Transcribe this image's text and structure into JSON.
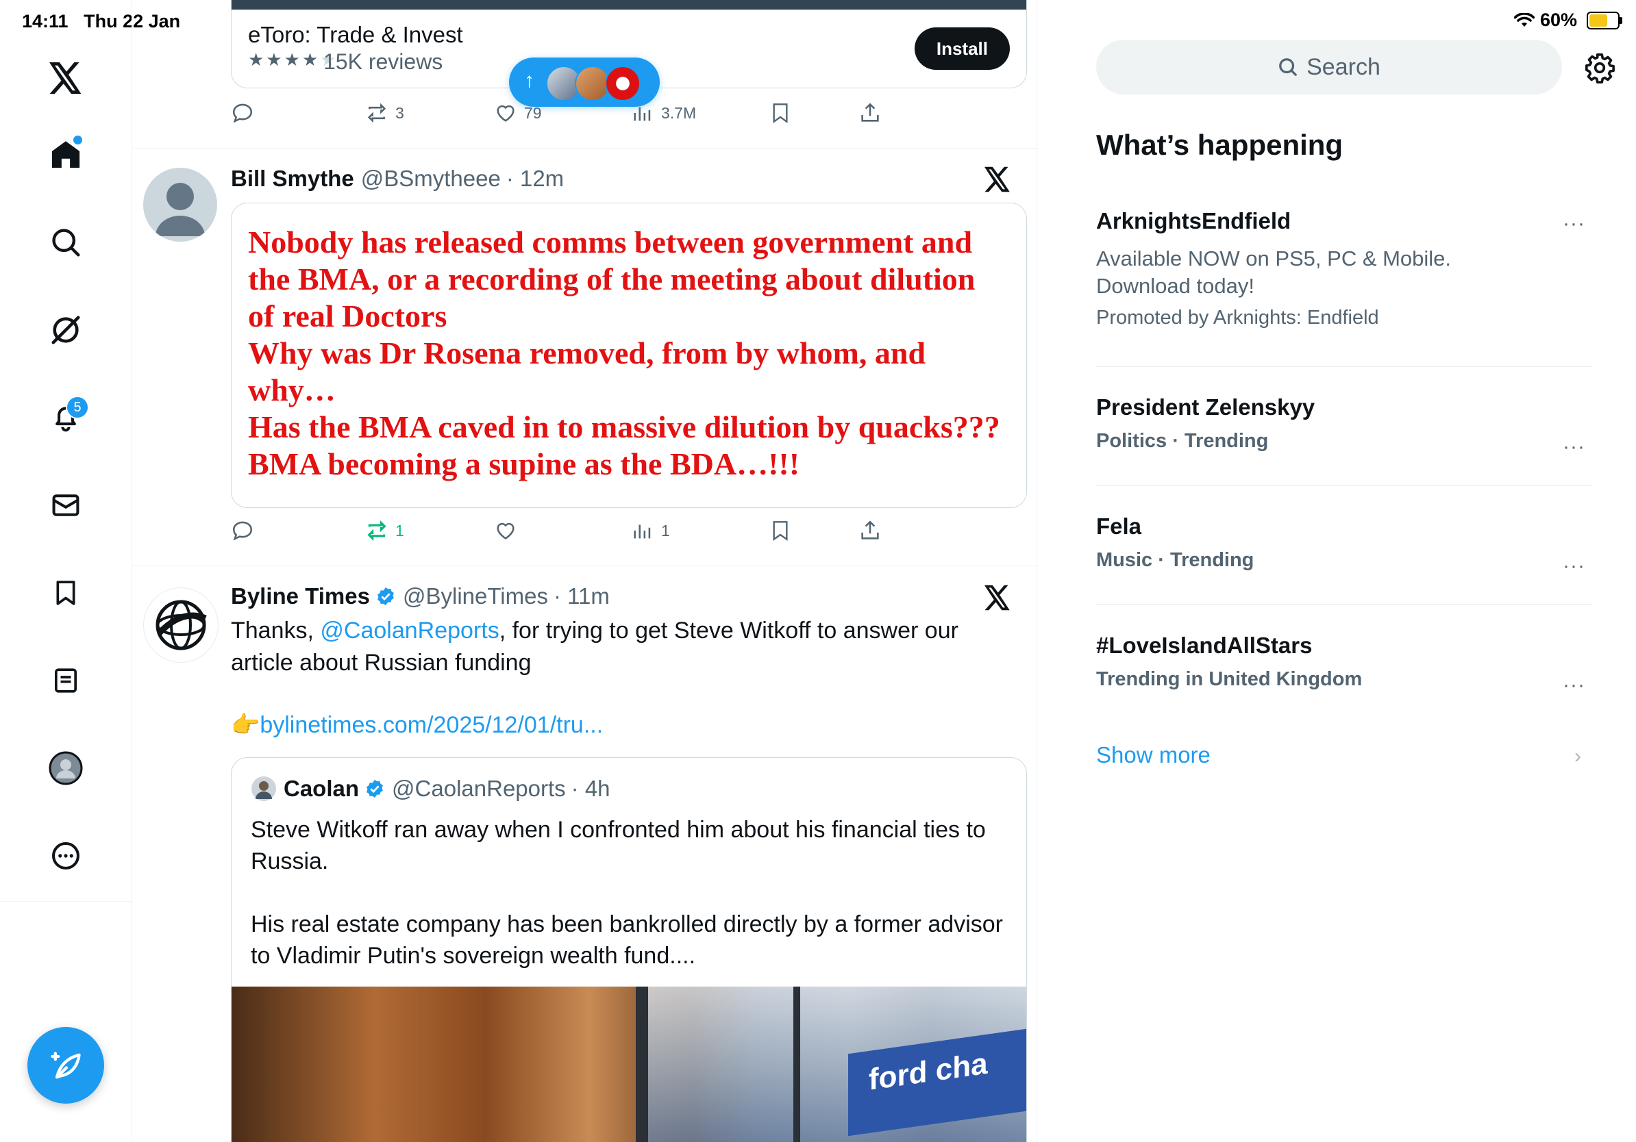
{
  "status_bar": {
    "time": "14:11",
    "date": "Thu 22 Jan",
    "battery": "60%"
  },
  "nav": {
    "notifications_badge": "5"
  },
  "ad": {
    "title": "eToro: Trade & Invest",
    "stars": "★★★★★",
    "reviews": "15K reviews",
    "install_label": "Install",
    "replies": "",
    "reposts": "3",
    "likes": "79",
    "views": "3.7M"
  },
  "post1": {
    "name": "Bill Smythe",
    "handle": "@BSmytheee",
    "time": "· 12m",
    "image_lines": [
      "Nobody has released comms between government and",
      "the BMA, or a recording of the meeting about dilution",
      "of real Doctors",
      "Why was Dr Rosena removed, from by whom, and",
      "why…",
      "Has the BMA caved in to massive dilution by quacks???",
      "BMA becoming a supine as the BDA…!!!"
    ],
    "reposts": "1",
    "views": "1"
  },
  "post2": {
    "name": "Byline Times",
    "handle": "@BylineTimes",
    "time": "· 11m",
    "text_before": "Thanks, ",
    "mention": "@CaolanReports",
    "text_after": ", for trying to get Steve Witkoff to answer our article about Russian funding",
    "emoji": "👉",
    "link": "bylinetimes.com/2025/12/01/tru...",
    "quote": {
      "name": "Caolan",
      "handle": "@CaolanReports",
      "time": "· 4h",
      "para1": "Steve Witkoff ran away when I confronted him about his financial ties to Russia.",
      "para2": "His real estate company has been bankrolled directly by a former advisor to Vladimir Putin's sovereign wealth fund....",
      "video_sign": "ford cha"
    }
  },
  "right": {
    "search_placeholder": "Search",
    "section_title": "What’s happening",
    "trends": [
      {
        "name": "ArknightsEndfield",
        "desc": "Available NOW on PS5, PC & Mobile. Download today!",
        "meta": "Promoted by Arknights: Endfield"
      },
      {
        "name": "President Zelenskyy",
        "meta": "Politics · Trending"
      },
      {
        "name": "Fela",
        "meta": "Music · Trending"
      },
      {
        "name": "#LoveIslandAllStars",
        "meta": "Trending in United Kingdom"
      }
    ],
    "show_more": "Show more",
    "more_glyph": "···"
  },
  "colors": {
    "accent": "#1d9bf0",
    "text": "#0f1419",
    "muted": "#536471",
    "repost_active": "#00ba7c",
    "red_text": "#e31212"
  }
}
